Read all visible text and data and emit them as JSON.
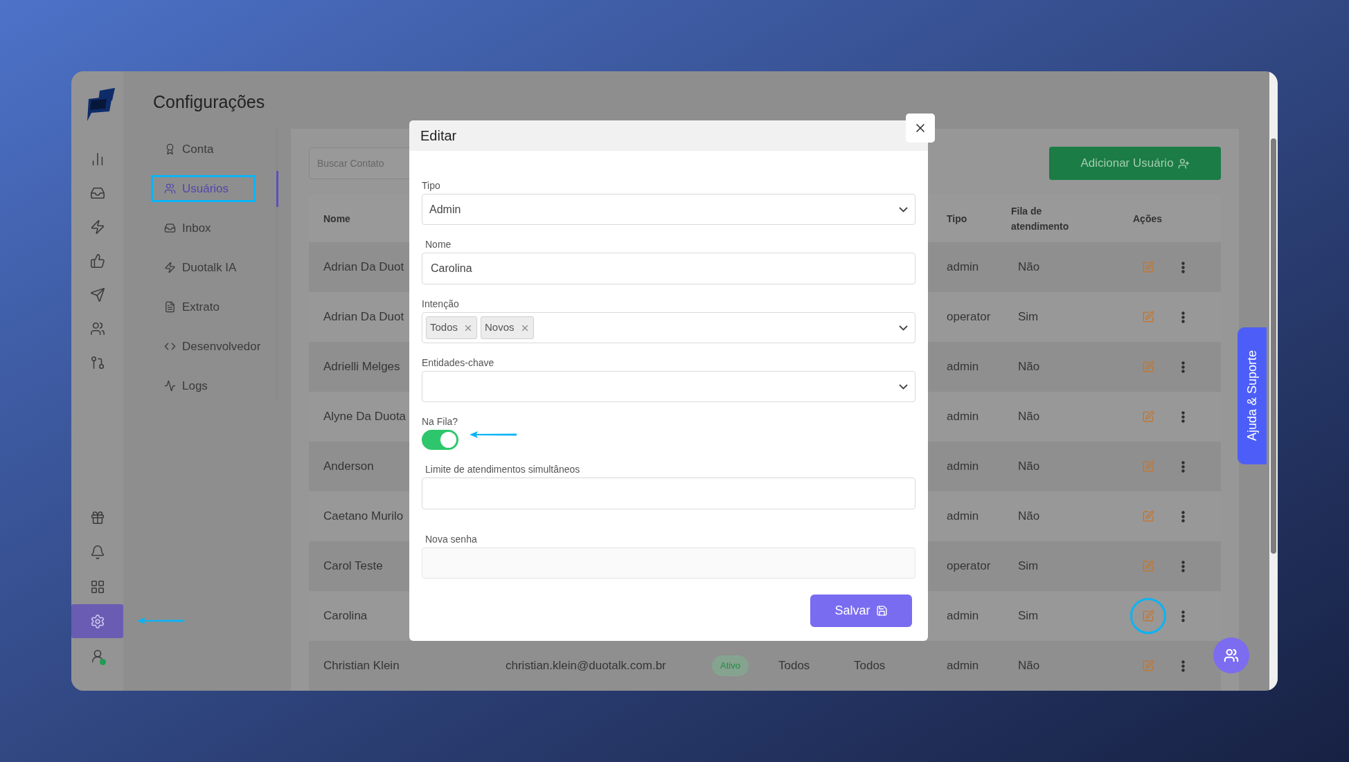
{
  "rail": {
    "top": [
      {
        "kind": "chart",
        "selected": false,
        "pointed": false
      },
      {
        "kind": "inbox",
        "selected": false,
        "pointed": false
      },
      {
        "kind": "zap",
        "selected": false,
        "pointed": false
      },
      {
        "kind": "thumbs",
        "selected": false,
        "pointed": false
      },
      {
        "kind": "send",
        "selected": false,
        "pointed": false
      },
      {
        "kind": "users",
        "selected": false,
        "pointed": false
      },
      {
        "kind": "git",
        "selected": false,
        "pointed": false
      }
    ],
    "bottom": [
      {
        "kind": "gift",
        "selected": false,
        "pointed": false
      },
      {
        "kind": "bell",
        "selected": false,
        "pointed": false
      },
      {
        "kind": "grid",
        "selected": false,
        "pointed": false
      },
      {
        "kind": "settings",
        "selected": true,
        "pointed": true
      },
      {
        "kind": "user",
        "selected": false,
        "pointed": false,
        "online": true
      }
    ]
  },
  "page": {
    "title": "Configurações"
  },
  "settings_menu": [
    {
      "kind": "award",
      "label": "Conta",
      "selected": false,
      "highlighted": false
    },
    {
      "kind": "users",
      "label": "Usuários",
      "selected": true,
      "highlighted": true
    },
    {
      "kind": "inbox",
      "label": "Inbox",
      "selected": false,
      "highlighted": false
    },
    {
      "kind": "zap",
      "label": "Duotalk IA",
      "selected": false,
      "highlighted": false
    },
    {
      "kind": "file",
      "label": "Extrato",
      "selected": false,
      "highlighted": false
    },
    {
      "kind": "code",
      "label": "Desenvolvedor",
      "selected": false,
      "highlighted": false
    },
    {
      "kind": "activity",
      "label": "Logs",
      "selected": false,
      "highlighted": false
    }
  ],
  "search": {
    "placeholder": "Buscar Contato"
  },
  "add_button": {
    "label": "Adicionar Usuário"
  },
  "table": {
    "columns": {
      "name": "Nome",
      "tipo": "Tipo",
      "fila": "Fila de atendimento",
      "acoes": "Ações"
    },
    "rows": [
      {
        "name": "Adrian Da Duot",
        "tipo": "admin",
        "fila": "Não",
        "highlighted": false
      },
      {
        "name": "Adrian Da Duot",
        "tipo": "operator",
        "fila": "Sim",
        "highlighted": false
      },
      {
        "name": "Adrielli Melges",
        "tipo": "admin",
        "fila": "Não",
        "highlighted": false
      },
      {
        "name": "Alyne Da Duota",
        "tipo": "admin",
        "fila": "Não",
        "highlighted": false
      },
      {
        "name": "Anderson",
        "tipo": "admin",
        "fila": "Não",
        "highlighted": false
      },
      {
        "name": "Caetano Murilo",
        "tipo": "admin",
        "fila": "Não",
        "highlighted": false
      },
      {
        "name": "Carol Teste",
        "tipo": "operator",
        "fila": "Sim",
        "highlighted": false
      },
      {
        "name": "Carolina",
        "tipo": "admin",
        "fila": "Sim",
        "highlighted": true
      },
      {
        "name": "Christian Klein",
        "email": "christian.klein@duotalk.com.br",
        "status": "Ativo",
        "column_4": "Todos",
        "column_5": "Todos",
        "tipo": "admin",
        "fila": "Não",
        "highlighted": false
      }
    ]
  },
  "help_tab": {
    "label": "Ajuda & Suporte"
  },
  "modal": {
    "title": "Editar",
    "fields": [
      {
        "kind": "select",
        "label": "Tipo",
        "value": "Admin"
      },
      {
        "kind": "text",
        "label": "Nome",
        "value": "Carolina"
      },
      {
        "kind": "tags",
        "label": "Intenção",
        "tags": [
          "Todos",
          "Novos"
        ]
      },
      {
        "kind": "select",
        "label": "Entidades-chave"
      },
      {
        "kind": "toggle",
        "label": "Na Fila?",
        "on": true,
        "pointed": true
      },
      {
        "kind": "text",
        "label": "Limite de atendimentos simultâneos"
      },
      {
        "kind": "password",
        "label": "Nova senha"
      }
    ],
    "save_button": {
      "label": "Salvar"
    }
  }
}
